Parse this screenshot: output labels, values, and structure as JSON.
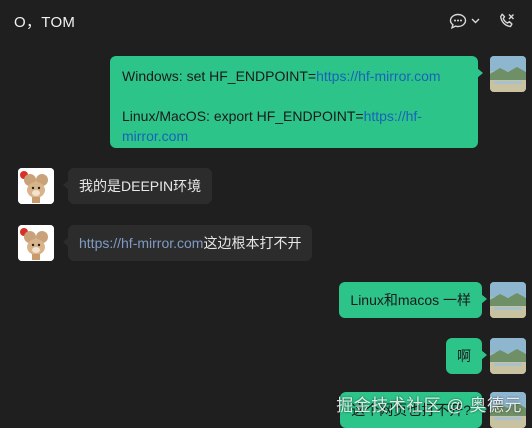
{
  "header": {
    "title": "O，TOM",
    "icons": [
      "chat-bubble-icon",
      "chevron-down-icon",
      "phone-icon"
    ]
  },
  "messages": [
    {
      "direction": "out",
      "line1_prefix": "Windows: set HF_ENDPOINT=",
      "line1_link": "https://hf-mirror.com",
      "line2_prefix": "Linux/MacOS: export HF_ENDPOINT=",
      "line2_link_a": "https://hf-",
      "line2_link_b": "mirror.com"
    },
    {
      "direction": "in",
      "text": "我的是DEEPIN环境"
    },
    {
      "direction": "in",
      "link": "https://hf-mirror.com",
      "text": "这边根本打不开"
    },
    {
      "direction": "out",
      "text": "Linux和macos 一样"
    },
    {
      "direction": "out",
      "text": "啊"
    },
    {
      "direction": "out",
      "text": "这个网页也打不开?"
    }
  ],
  "watermark": "掘金技术社区 @ 奥德元",
  "colors": {
    "outgoing_bubble": "#2dc48a",
    "incoming_bubble": "#2c2c2c",
    "background": "#1f1f1f"
  }
}
